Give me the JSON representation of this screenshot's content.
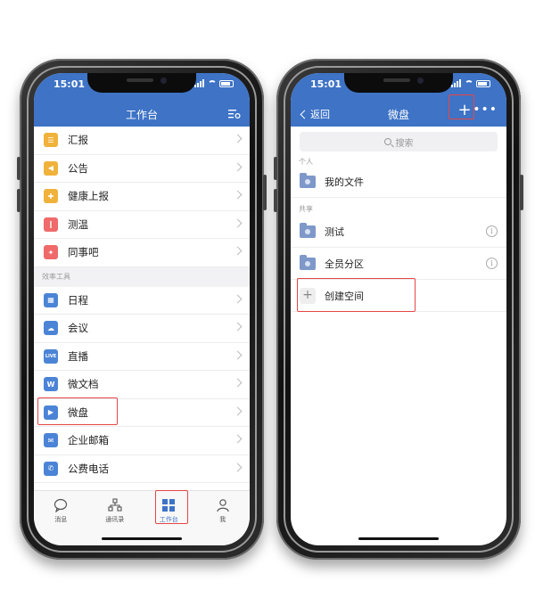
{
  "left": {
    "status_time": "15:01",
    "title": "工作台",
    "primary_items": [
      {
        "label": "汇报",
        "icon": "report-icon",
        "color": "#f0b23a",
        "glyph": "☰"
      },
      {
        "label": "公告",
        "icon": "megaphone-icon",
        "color": "#f0b23a",
        "glyph": "◀"
      },
      {
        "label": "健康上报",
        "icon": "health-report-icon",
        "color": "#f0b23a",
        "glyph": "✚"
      },
      {
        "label": "测温",
        "icon": "thermometer-icon",
        "color": "#ef6a6a",
        "glyph": "❙"
      },
      {
        "label": "同事吧",
        "icon": "colleague-circle-icon",
        "color": "#ef6a6a",
        "glyph": "✦"
      }
    ],
    "section_label": "效率工具",
    "tool_items": [
      {
        "label": "日程",
        "icon": "calendar-icon",
        "color": "#4b84d6",
        "glyph": "▦"
      },
      {
        "label": "会议",
        "icon": "meeting-cloud-icon",
        "color": "#4b84d6",
        "glyph": "☁"
      },
      {
        "label": "直播",
        "icon": "live-icon",
        "color": "#4b84d6",
        "glyph": "LIVE"
      },
      {
        "label": "微文档",
        "icon": "doc-w-icon",
        "color": "#4b84d6",
        "glyph": "W"
      },
      {
        "label": "微盘",
        "icon": "drive-icon",
        "color": "#4b84d6",
        "glyph": "▶"
      },
      {
        "label": "企业邮箱",
        "icon": "mail-icon",
        "color": "#4b84d6",
        "glyph": "✉"
      },
      {
        "label": "公费电话",
        "icon": "phone-icon",
        "color": "#4b84d6",
        "glyph": "✆"
      }
    ],
    "tabs": [
      {
        "label": "消息",
        "icon": "message-icon"
      },
      {
        "label": "通讯录",
        "icon": "contacts-icon"
      },
      {
        "label": "工作台",
        "icon": "workbench-icon"
      },
      {
        "label": "我",
        "icon": "profile-icon"
      }
    ],
    "active_tab": "工作台"
  },
  "right": {
    "status_time": "15:01",
    "back_label": "返回",
    "title": "微盘",
    "search_placeholder": "搜索",
    "personal_label": "个人",
    "personal_item": "我的文件",
    "shared_label": "共享",
    "shared_items": [
      "测试",
      "全员分区"
    ],
    "create_label": "创建空间"
  },
  "colors": {
    "header": "#3e73c6",
    "highlight": "#e54646"
  }
}
